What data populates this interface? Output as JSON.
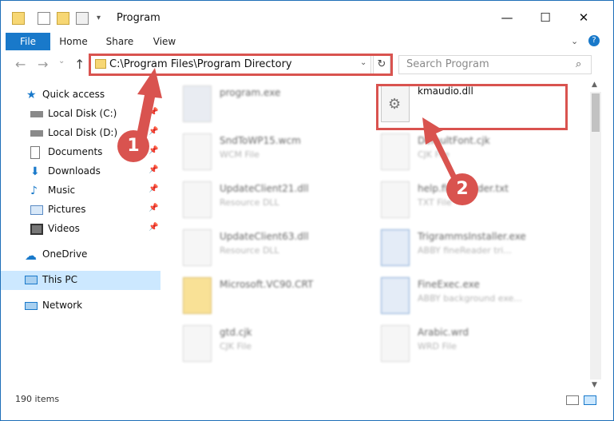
{
  "window": {
    "title": "Program"
  },
  "ribbon": {
    "tabs": [
      "File",
      "Home",
      "Share",
      "View"
    ]
  },
  "address": {
    "path": "C:\\Program Files\\Program Directory"
  },
  "search": {
    "placeholder": "Search Program"
  },
  "nav": {
    "items": [
      {
        "label": "Quick access",
        "icon": "star-icon"
      },
      {
        "label": "Local Disk (C:)",
        "icon": "drive-icon"
      },
      {
        "label": "Local Disk (D:)",
        "icon": "drive-icon"
      },
      {
        "label": "Documents",
        "icon": "documents-icon"
      },
      {
        "label": "Downloads",
        "icon": "download-icon"
      },
      {
        "label": "Music",
        "icon": "music-icon"
      },
      {
        "label": "Pictures",
        "icon": "pictures-icon"
      },
      {
        "label": "Videos",
        "icon": "videos-icon"
      },
      {
        "label": "OneDrive",
        "icon": "cloud-icon"
      },
      {
        "label": "This PC",
        "icon": "computer-icon"
      },
      {
        "label": "Network",
        "icon": "network-icon"
      }
    ]
  },
  "files": [
    {
      "name": "program.exe",
      "type": ""
    },
    {
      "name": "kmaudio.dll",
      "type": ""
    },
    {
      "name": "SndToWP15.wcm",
      "type": "WCM File"
    },
    {
      "name": "DefaultFont.cjk",
      "type": "CJK File"
    },
    {
      "name": "UpdateClient21.dll",
      "type": "Resource DLL"
    },
    {
      "name": "help.fineReader.txt",
      "type": "TXT File"
    },
    {
      "name": "UpdateClient63.dll",
      "type": "Resource DLL"
    },
    {
      "name": "TrigrammsInstaller.exe",
      "type": "ABBY fineReader tri..."
    },
    {
      "name": "Microsoft.VC90.CRT",
      "type": ""
    },
    {
      "name": "FineExec.exe",
      "type": "ABBY background exe..."
    },
    {
      "name": "gtd.cjk",
      "type": "CJK File"
    },
    {
      "name": "Arabic.wrd",
      "type": "WRD File"
    }
  ],
  "status": {
    "items_count": "190 items"
  },
  "annotations": {
    "badge1": "1",
    "badge2": "2"
  },
  "colors": {
    "accent": "#1979ca",
    "highlight": "#d9534f",
    "selection": "#cce8ff"
  }
}
